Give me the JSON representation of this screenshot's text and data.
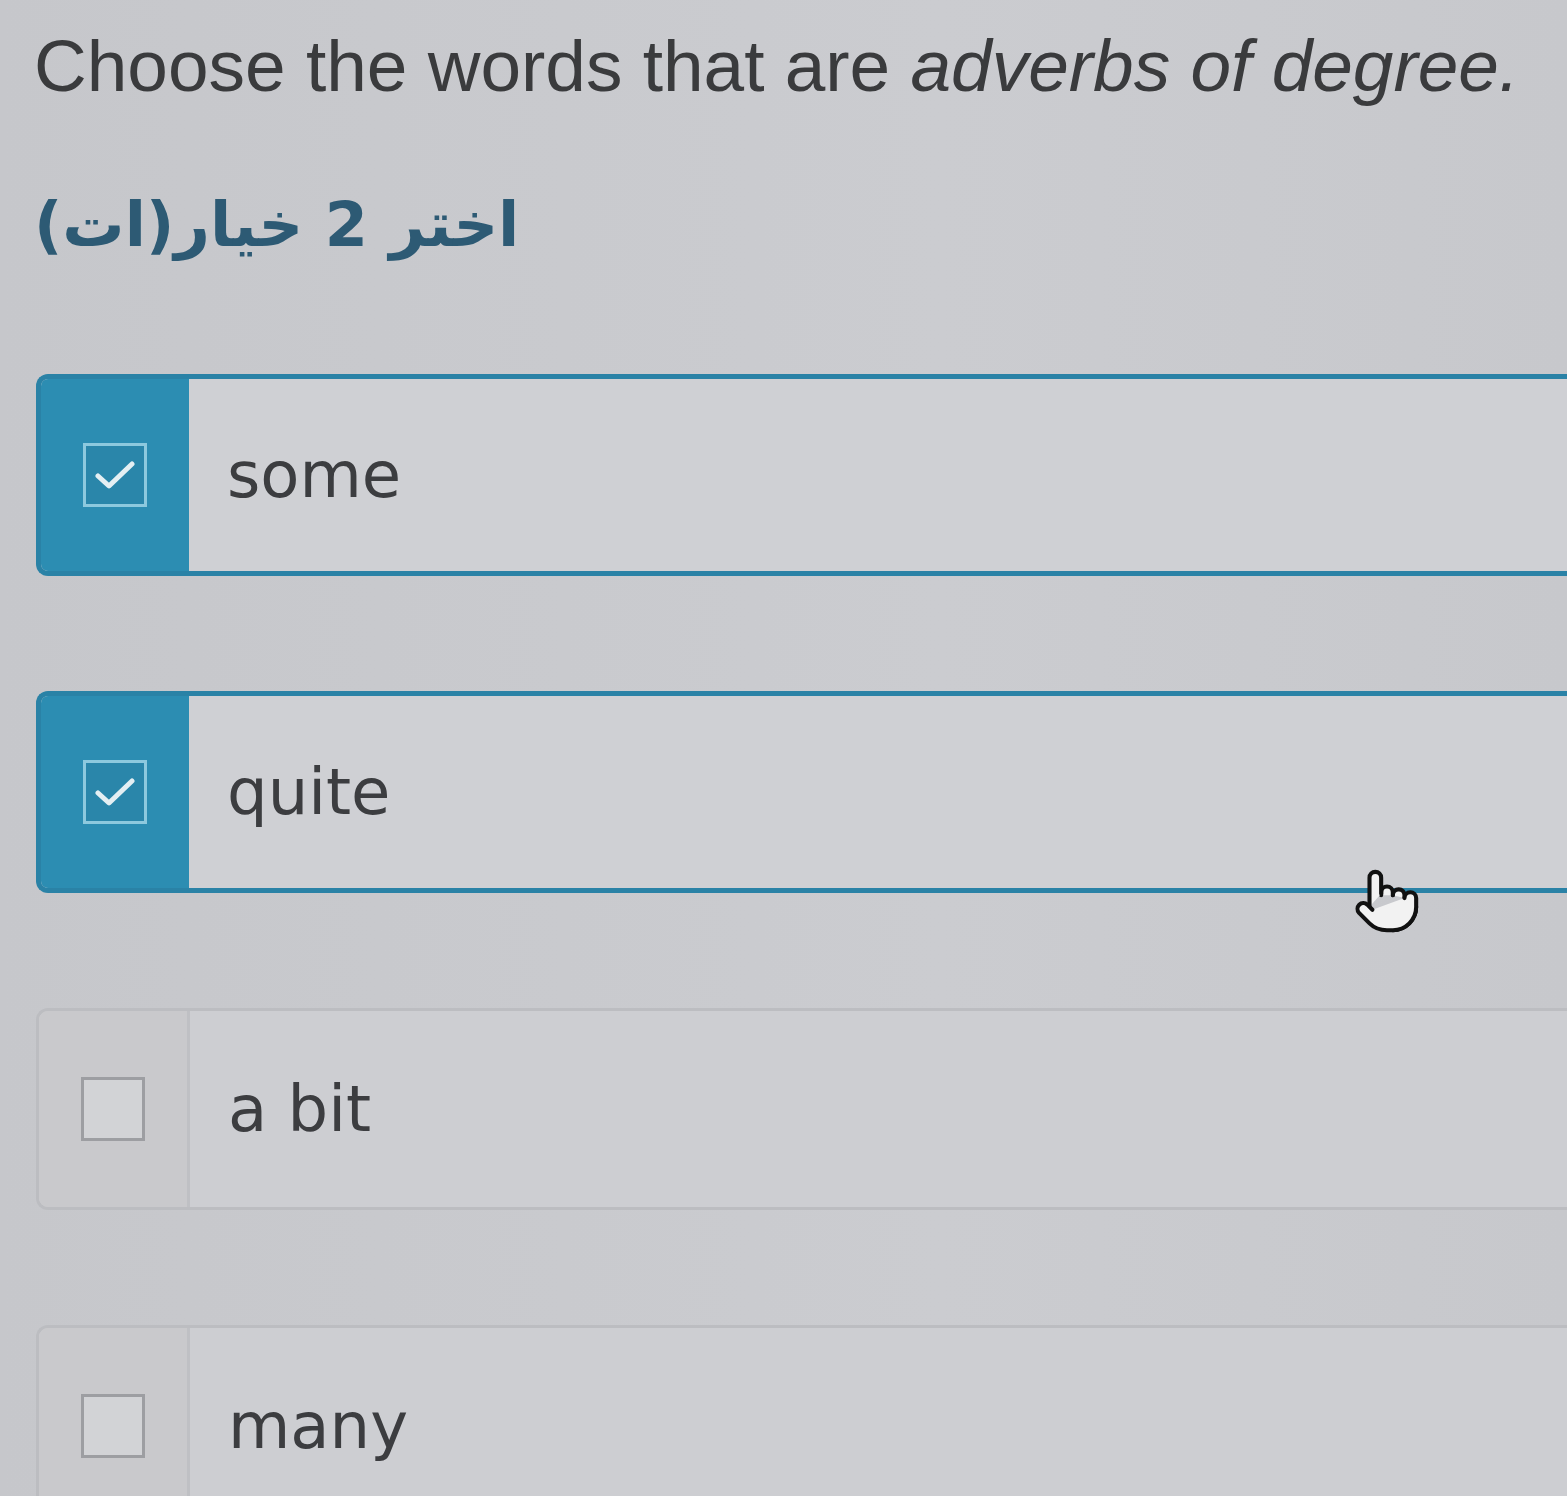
{
  "question": {
    "text": "Choose the words that are *adverbs of degree.*"
  },
  "instruction": {
    "text": "اختر 2 خيار(ات)"
  },
  "options": [
    {
      "label": "some",
      "checked": true
    },
    {
      "label": "quite",
      "checked": true
    },
    {
      "label": "a bit",
      "checked": false
    },
    {
      "label": "many",
      "checked": false
    }
  ]
}
